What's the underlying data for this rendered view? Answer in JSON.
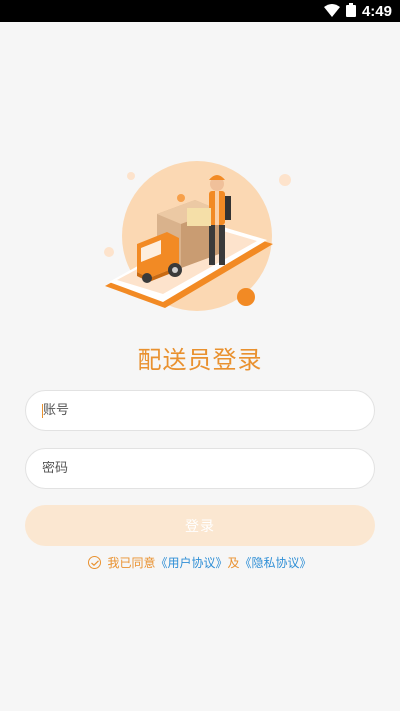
{
  "status": {
    "time": "4:49"
  },
  "title": "配送员登录",
  "form": {
    "account_placeholder": "账号",
    "password_placeholder": "密码",
    "login_label": "登录"
  },
  "agreement": {
    "prefix": "我已同意",
    "user_agreement": "《用户协议》",
    "conjunction": "及",
    "privacy_agreement": "《隐私协议》"
  },
  "colors": {
    "accent": "#e9912f",
    "link": "#2f8fd6",
    "button_disabled": "#fbe7d1"
  },
  "icons": [
    "wifi-icon",
    "battery-icon",
    "checkbox-icon",
    "delivery-illustration"
  ]
}
